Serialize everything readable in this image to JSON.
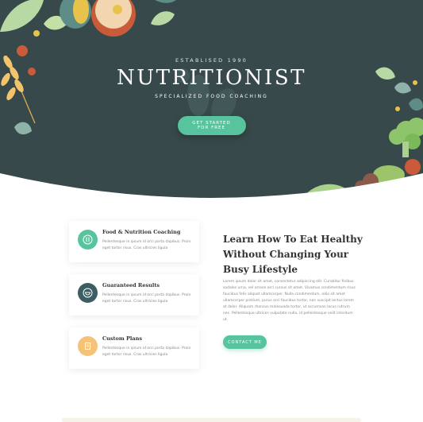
{
  "hero": {
    "established": "ESTABLISED 1990",
    "brand": "NUTRITIONIST",
    "tagline": "SPECIALIZED FOOD COACHING",
    "cta_label": "GET STARTED FOR FREE"
  },
  "features": [
    {
      "title": "Food & Nutrition Coaching",
      "desc": "Pellentesque in ipsum id orci porta dapibus. Proin eget tortor risus. Cras ultricies ligula",
      "icon": "cutlery-icon",
      "color": "#57c49d"
    },
    {
      "title": "Guaranteed Results",
      "desc": "Pellentesque in ipsum id orci porta dapibus. Proin eget tortor risus. Cras ultricies ligula",
      "icon": "bowl-icon",
      "color": "#3c5d61"
    },
    {
      "title": "Custom Plans",
      "desc": "Pellentesque in ipsum id orci porta dapibus. Proin eget tortor risus. Cras ultricies ligula",
      "icon": "plan-icon",
      "color": "#f5c27a"
    }
  ],
  "about": {
    "headline_line1": "Learn How To Eat Healthy",
    "headline_line2": "Without Changing Your",
    "headline_line3": "Busy Lifestyle",
    "body": "Lorem ipsum dolor sit amet, consectetur adipiscing elit. Curabitur finibus sodales urna, vel ornare orci cursus sit amet. Vivamus condimentum risus faucibus felis aliquet ullamcorper. Nulla condimentum, odio sit amet ullamcorper pretium, purus orci faucibus tortor, non suscipit lectus lorem at dolor. Aliquam rhoncus malesuada tortor, ut accumsan lacus rutrum nec. Pellentesque ultrices vulputate nulla, id pellentesque velit interdum ut.",
    "contact_label": "CONTACT ME"
  },
  "colors": {
    "hero_bg": "#37494a",
    "accent": "#57c49d"
  }
}
